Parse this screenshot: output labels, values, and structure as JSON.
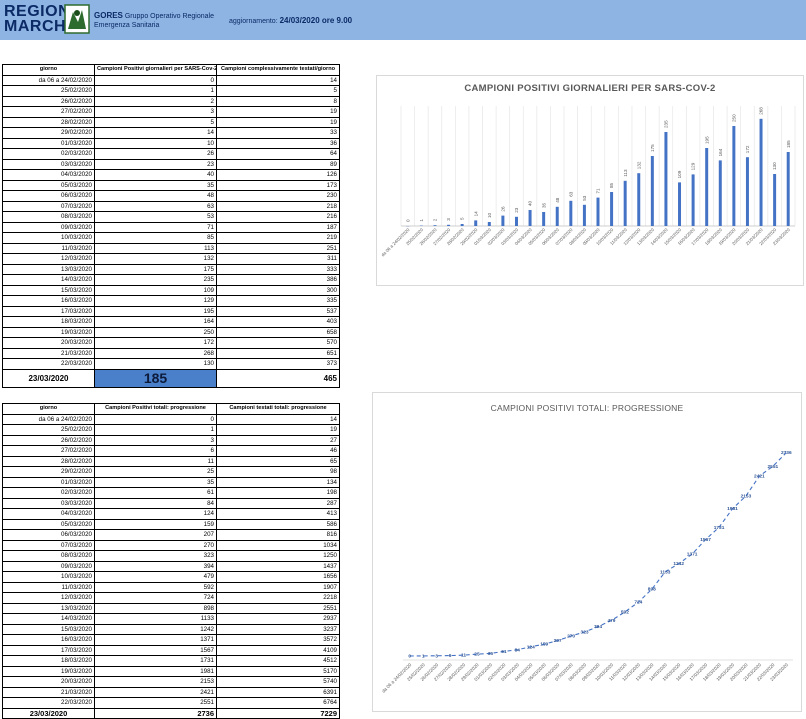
{
  "header": {
    "logo_line1": "REGIONE",
    "logo_line2": "MARCHE",
    "gores_name": "GORES",
    "gores_desc1": "Gruppo Operativo Regionale",
    "gores_desc2": "Emergenza Sanitaria",
    "update_label": "aggiornamento:",
    "update_value": "24/03/2020 ore 9.00",
    "bg_color": "#8eb4e3"
  },
  "table1": {
    "headers": [
      "giorno",
      "Campioni Positivi giornalieri per SARS-Cov-2",
      "Campioni complessivamente testati/giorno"
    ],
    "rows": [
      [
        "da 06 a 24/02/2020",
        "0",
        "14"
      ],
      [
        "25/02/2020",
        "1",
        "5"
      ],
      [
        "26/02/2020",
        "2",
        "8"
      ],
      [
        "27/02/2020",
        "3",
        "19"
      ],
      [
        "28/02/2020",
        "5",
        "19"
      ],
      [
        "29/02/2020",
        "14",
        "33"
      ],
      [
        "01/03/2020",
        "10",
        "36"
      ],
      [
        "02/03/2020",
        "26",
        "64"
      ],
      [
        "03/03/2020",
        "23",
        "89"
      ],
      [
        "04/03/2020",
        "40",
        "126"
      ],
      [
        "05/03/2020",
        "35",
        "173"
      ],
      [
        "06/03/2020",
        "48",
        "230"
      ],
      [
        "07/03/2020",
        "63",
        "218"
      ],
      [
        "08/03/2020",
        "53",
        "216"
      ],
      [
        "09/03/2020",
        "71",
        "187"
      ],
      [
        "10/03/2020",
        "85",
        "219"
      ],
      [
        "11/03/2020",
        "113",
        "251"
      ],
      [
        "12/03/2020",
        "132",
        "311"
      ],
      [
        "13/03/2020",
        "175",
        "333"
      ],
      [
        "14/03/2020",
        "235",
        "386"
      ],
      [
        "15/03/2020",
        "109",
        "300"
      ],
      [
        "16/03/2020",
        "129",
        "335"
      ],
      [
        "17/03/2020",
        "195",
        "537"
      ],
      [
        "18/03/2020",
        "164",
        "403"
      ],
      [
        "19/03/2020",
        "250",
        "658"
      ],
      [
        "20/03/2020",
        "172",
        "570"
      ],
      [
        "21/03/2020",
        "268",
        "651"
      ],
      [
        "22/03/2020",
        "130",
        "373"
      ]
    ],
    "total": [
      "23/03/2020",
      "185",
      "465"
    ],
    "highlight_color": "#4a7fc9"
  },
  "table2": {
    "headers": [
      "giorno",
      "Campioni Positivi totali: progressione",
      "Campioni testati totali: progressione"
    ],
    "rows": [
      [
        "da 06 a 24/02/2020",
        "0",
        "14"
      ],
      [
        "25/02/2020",
        "1",
        "19"
      ],
      [
        "26/02/2020",
        "3",
        "27"
      ],
      [
        "27/02/2020",
        "6",
        "46"
      ],
      [
        "28/02/2020",
        "11",
        "65"
      ],
      [
        "29/02/2020",
        "25",
        "98"
      ],
      [
        "01/03/2020",
        "35",
        "134"
      ],
      [
        "02/03/2020",
        "61",
        "198"
      ],
      [
        "03/03/2020",
        "84",
        "287"
      ],
      [
        "04/03/2020",
        "124",
        "413"
      ],
      [
        "05/03/2020",
        "159",
        "586"
      ],
      [
        "06/03/2020",
        "207",
        "816"
      ],
      [
        "07/03/2020",
        "270",
        "1034"
      ],
      [
        "08/03/2020",
        "323",
        "1250"
      ],
      [
        "09/03/2020",
        "394",
        "1437"
      ],
      [
        "10/03/2020",
        "479",
        "1656"
      ],
      [
        "11/03/2020",
        "592",
        "1907"
      ],
      [
        "12/03/2020",
        "724",
        "2218"
      ],
      [
        "13/03/2020",
        "898",
        "2551"
      ],
      [
        "14/03/2020",
        "1133",
        "2937"
      ],
      [
        "15/03/2020",
        "1242",
        "3237"
      ],
      [
        "16/03/2020",
        "1371",
        "3572"
      ],
      [
        "17/03/2020",
        "1567",
        "4109"
      ],
      [
        "18/03/2020",
        "1731",
        "4512"
      ],
      [
        "19/03/2020",
        "1981",
        "5170"
      ],
      [
        "20/03/2020",
        "2153",
        "5740"
      ],
      [
        "21/03/2020",
        "2421",
        "6391"
      ],
      [
        "22/03/2020",
        "2551",
        "6764"
      ]
    ],
    "total": [
      "23/03/2020",
      "2736",
      "7229"
    ]
  },
  "chart_data": [
    {
      "type": "bar",
      "title": "CAMPIONI POSITIVI GIORNALIERI PER SARS-COV-2",
      "xlabel": "",
      "ylabel": "",
      "categories": [
        "da 06 a 24/02/2020",
        "25/02/2020",
        "26/02/2020",
        "27/02/2020",
        "28/02/2020",
        "29/02/2020",
        "01/03/2020",
        "02/03/2020",
        "03/03/2020",
        "04/03/2020",
        "05/03/2020",
        "06/03/2020",
        "07/03/2020",
        "08/03/2020",
        "09/03/2020",
        "10/03/2020",
        "11/03/2020",
        "12/03/2020",
        "13/03/2020",
        "14/03/2020",
        "15/03/2020",
        "16/03/2020",
        "17/03/2020",
        "18/03/2020",
        "19/03/2020",
        "20/03/2020",
        "21/03/2020",
        "22/03/2020",
        "23/03/2020"
      ],
      "values": [
        0,
        1,
        2,
        3,
        5,
        14,
        10,
        26,
        23,
        40,
        35,
        48,
        63,
        53,
        71,
        85,
        113,
        132,
        175,
        235,
        109,
        129,
        195,
        164,
        250,
        172,
        268,
        130,
        185
      ],
      "ylim": [
        0,
        300
      ],
      "grid": "vertical",
      "legend": "none",
      "color": "#4472c4"
    },
    {
      "type": "line",
      "title": "CAMPIONI POSITIVI TOTALI: PROGRESSIONE",
      "xlabel": "",
      "ylabel": "",
      "categories": [
        "da 06 a 24/02/2020",
        "25/02/2020",
        "26/02/2020",
        "27/02/2020",
        "28/02/2020",
        "29/02/2020",
        "01/03/2020",
        "02/03/2020",
        "03/03/2020",
        "04/03/2020",
        "05/03/2020",
        "06/03/2020",
        "07/03/2020",
        "08/03/2020",
        "09/03/2020",
        "10/03/2020",
        "11/03/2020",
        "12/03/2020",
        "13/03/2020",
        "14/03/2020",
        "15/03/2020",
        "16/03/2020",
        "17/03/2020",
        "18/03/2020",
        "19/03/2020",
        "20/03/2020",
        "21/03/2020",
        "22/03/2020",
        "23/03/2020"
      ],
      "values": [
        0,
        1,
        3,
        6,
        11,
        25,
        35,
        61,
        84,
        124,
        159,
        207,
        270,
        323,
        394,
        479,
        592,
        724,
        898,
        1133,
        1242,
        1371,
        1567,
        1731,
        1981,
        2153,
        2421,
        2551,
        2736
      ],
      "ylim": [
        0,
        3000
      ],
      "grid": "none",
      "legend": "none",
      "line_style": "dashed",
      "color": "#4472c4"
    }
  ]
}
